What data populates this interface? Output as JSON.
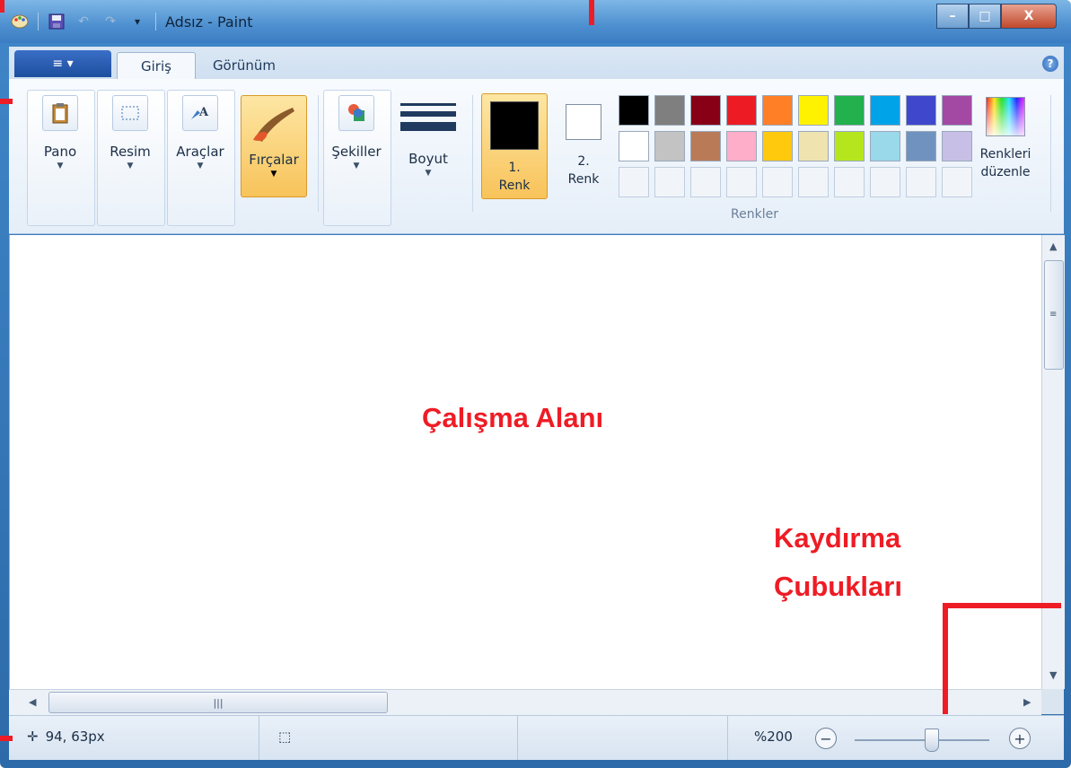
{
  "window": {
    "title": "Adsız - Paint",
    "qat_icons": [
      "paint-app-icon",
      "save-icon",
      "undo-icon",
      "redo-icon",
      "customize-qat-icon"
    ],
    "controls": {
      "minimize": "–",
      "maximize": "□",
      "close": "X"
    }
  },
  "tabs": {
    "file_menu_icon": "≡ ▾",
    "home": "Giriş",
    "view": "Görünüm",
    "help": "?"
  },
  "ribbon": {
    "clipboard": {
      "label": "Pano"
    },
    "image": {
      "label": "Resim"
    },
    "tools": {
      "label": "Araçlar"
    },
    "brushes": {
      "label": "Fırçalar"
    },
    "shapes": {
      "label": "Şekiller"
    },
    "size": {
      "label": "Boyut"
    },
    "color1": {
      "line1": "1.",
      "line2": "Renk",
      "color": "#000000"
    },
    "color2": {
      "line1": "2.",
      "line2": "Renk",
      "color": "#ffffff"
    },
    "edit_colors": {
      "line1": "Renkleri",
      "line2": "düzenle"
    },
    "colors_group_title": "Renkler",
    "palette": [
      [
        "#000000",
        "#7f7f7f",
        "#880015",
        "#ed1c24",
        "#ff7f27",
        "#fff200",
        "#22b14c",
        "#00a2e8",
        "#3f48cc",
        "#a349a4"
      ],
      [
        "#ffffff",
        "#c3c3c3",
        "#b97a57",
        "#ffaec9",
        "#ffc90e",
        "#efe4b0",
        "#b5e61d",
        "#99d9ea",
        "#7092be",
        "#c8bfe7"
      ]
    ],
    "empty_slots": 10
  },
  "canvas": {
    "annotation_label": "Çalışma Alanı"
  },
  "annotations": {
    "scrollbars_line1": "Kaydırma",
    "scrollbars_line2": "Çubukları"
  },
  "statusbar": {
    "cursor_position": "94, 63px",
    "zoom": "%200",
    "zoom_out": "−",
    "zoom_in": "+"
  }
}
